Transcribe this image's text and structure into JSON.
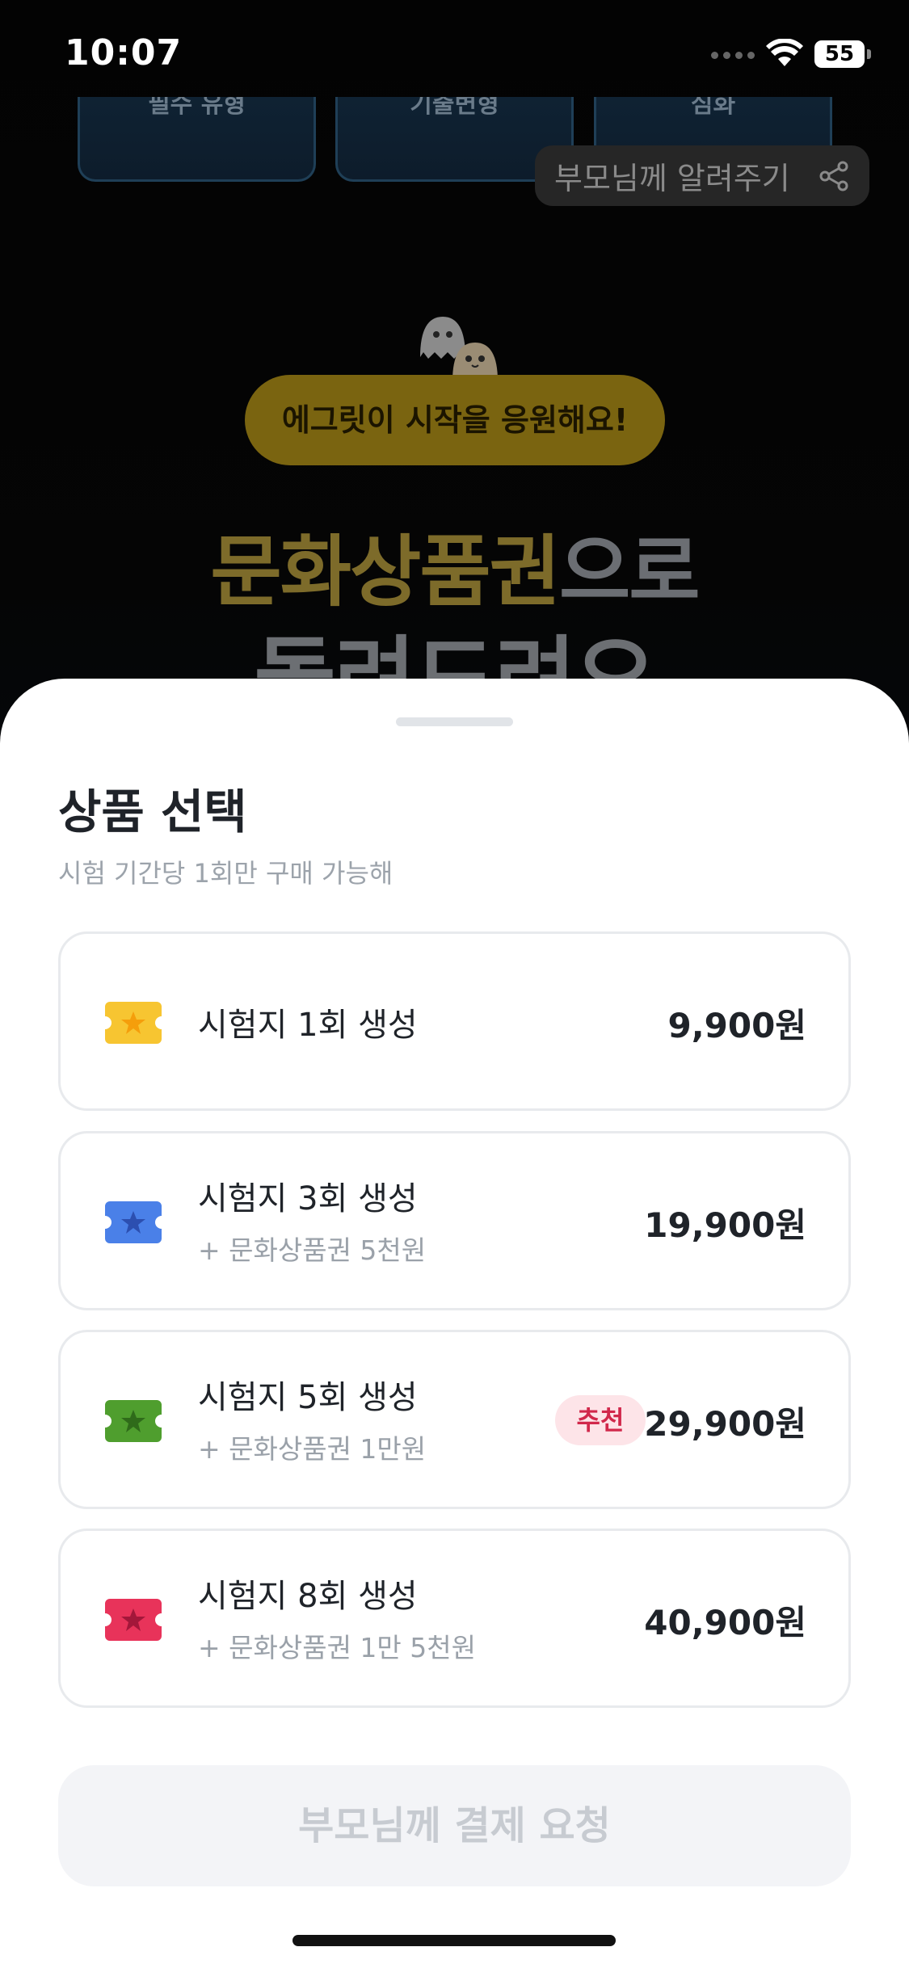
{
  "status_bar": {
    "time": "10:07",
    "battery": "55"
  },
  "background": {
    "chips": [
      "필수 유형",
      "기출변형",
      "심화"
    ],
    "share_label": "부모님께 알려주기",
    "cheer_text": "에그릿이 시작을 응원해요!",
    "headline_gold": "문화상품권",
    "headline_rest": "으로",
    "headline_line2": "돌려드려요"
  },
  "sheet": {
    "title": "상품 선택",
    "subtitle": "시험 기간당 1회만 구매 가능해",
    "products": [
      {
        "title": "시험지 1회 생성",
        "sub": "",
        "price": "9,900원",
        "badge": "",
        "ticket_color": "#f7c531",
        "star_color": "#f59e0b"
      },
      {
        "title": "시험지 3회 생성",
        "sub": "+ 문화상품권 5천원",
        "price": "19,900원",
        "badge": "",
        "ticket_color": "#4a80e8",
        "star_color": "#2c4fb0"
      },
      {
        "title": "시험지 5회 생성",
        "sub": "+ 문화상품권 1만원",
        "price": "29,900원",
        "badge": "추천",
        "ticket_color": "#4f9e2e",
        "star_color": "#2f6b1a"
      },
      {
        "title": "시험지 8회 생성",
        "sub": "+ 문화상품권 1만 5천원",
        "price": "40,900원",
        "badge": "",
        "ticket_color": "#e8335a",
        "star_color": "#a3173a"
      }
    ],
    "cta_label": "부모님께 결제 요청"
  }
}
